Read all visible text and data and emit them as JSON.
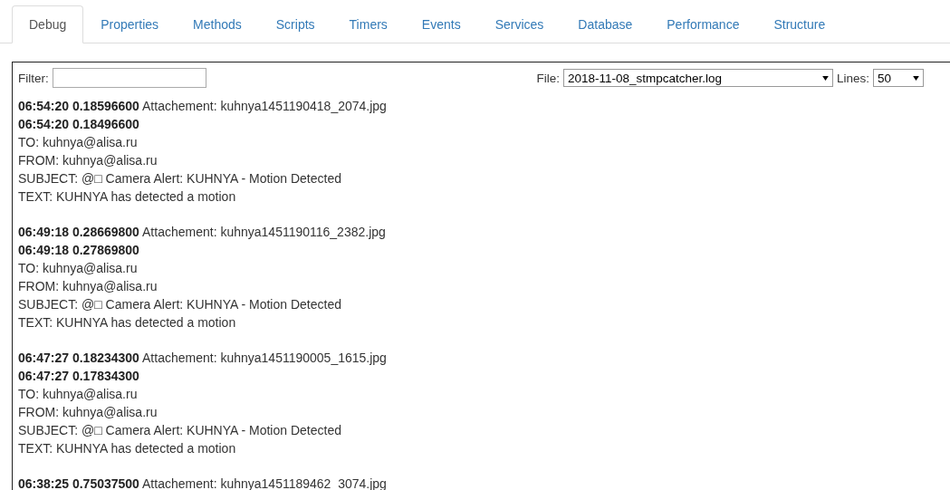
{
  "tabs": [
    {
      "label": "Debug",
      "selected": true
    },
    {
      "label": "Properties",
      "selected": false
    },
    {
      "label": "Methods",
      "selected": false
    },
    {
      "label": "Scripts",
      "selected": false
    },
    {
      "label": "Timers",
      "selected": false
    },
    {
      "label": "Events",
      "selected": false
    },
    {
      "label": "Services",
      "selected": false
    },
    {
      "label": "Database",
      "selected": false
    },
    {
      "label": "Performance",
      "selected": false
    },
    {
      "label": "Structure",
      "selected": false
    }
  ],
  "filter": {
    "label": "Filter:"
  },
  "file": {
    "label": "File:",
    "value": "2018-11-08_stmpcatcher.log"
  },
  "lines": {
    "label": "Lines:",
    "value": "50"
  },
  "log": [
    {
      "stamp": "06:54:20 0.18596600",
      "attachment": "Attachement: kuhnya1451190418_2074.jpg",
      "stamp2": "06:54:20 0.18496600",
      "lines": [
        "TO: kuhnya@alisa.ru",
        "FROM: kuhnya@alisa.ru",
        "SUBJECT: @□ Camera Alert: KUHNYA - Motion Detected",
        "TEXT: KUHNYA has detected a motion"
      ]
    },
    {
      "stamp": "06:49:18 0.28669800",
      "attachment": "Attachement: kuhnya1451190116_2382.jpg",
      "stamp2": "06:49:18 0.27869800",
      "lines": [
        "TO: kuhnya@alisa.ru",
        "FROM: kuhnya@alisa.ru",
        "SUBJECT: @□ Camera Alert: KUHNYA - Motion Detected",
        "TEXT: KUHNYA has detected a motion"
      ]
    },
    {
      "stamp": "06:47:27 0.18234300",
      "attachment": "Attachement: kuhnya1451190005_1615.jpg",
      "stamp2": "06:47:27 0.17834300",
      "lines": [
        "TO: kuhnya@alisa.ru",
        "FROM: kuhnya@alisa.ru",
        "SUBJECT: @□ Camera Alert: KUHNYA - Motion Detected",
        "TEXT: KUHNYA has detected a motion"
      ]
    },
    {
      "stamp": "06:38:25 0.75037500",
      "attachment": "Attachement: kuhnya1451189462_3074.jpg"
    }
  ]
}
